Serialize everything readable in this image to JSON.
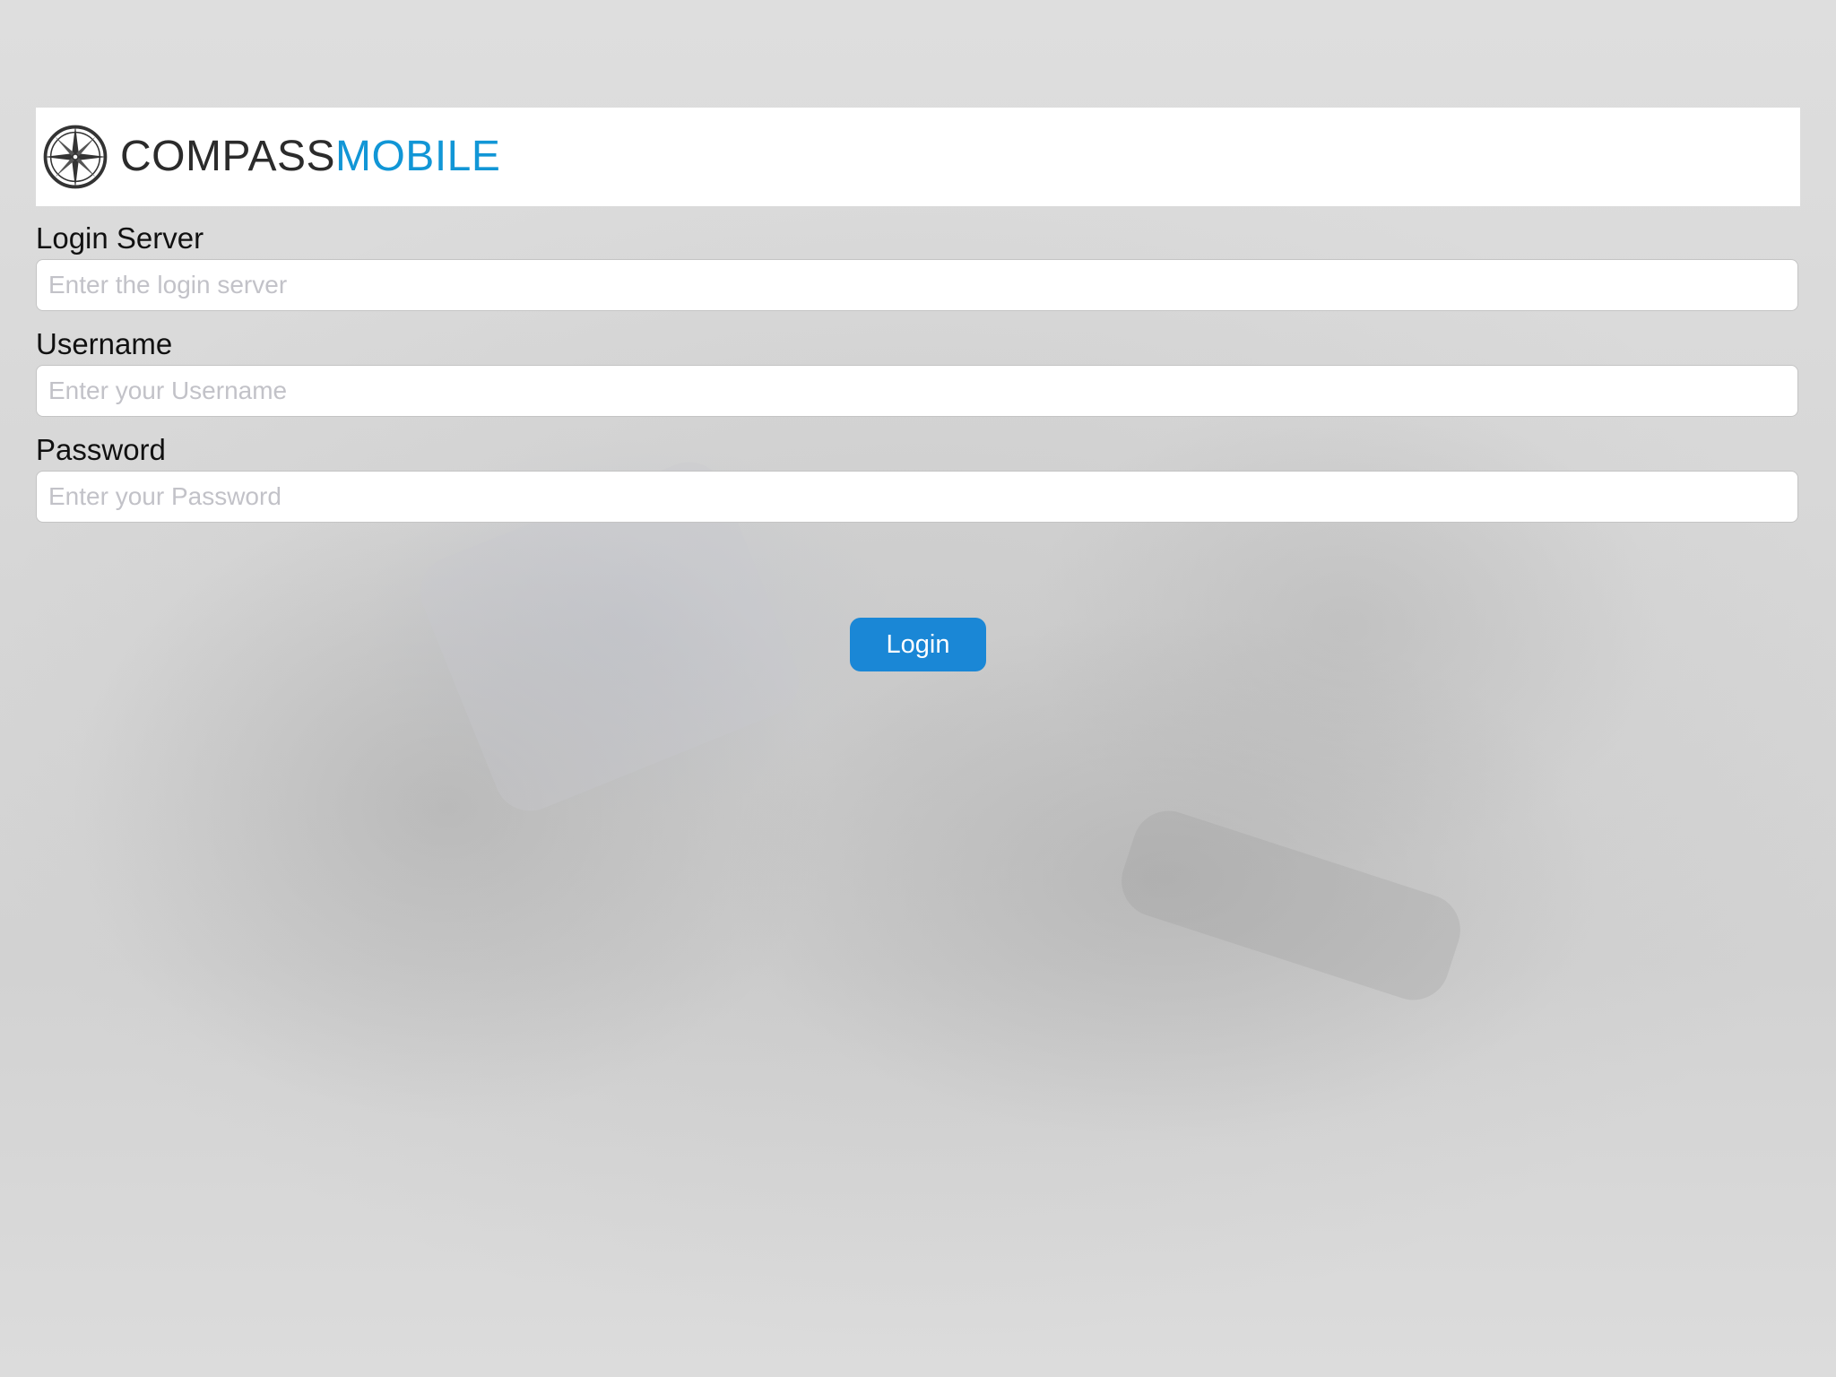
{
  "brand": {
    "name_part1": "COMPASS",
    "name_part2": "MOBILE",
    "logo_icon": "compass-rose-icon",
    "dark_color": "#2b2b2b",
    "accent_color": "#1196d6"
  },
  "form": {
    "login_server": {
      "label": "Login Server",
      "value": "",
      "placeholder": "Enter the login server"
    },
    "username": {
      "label": "Username",
      "value": "",
      "placeholder": "Enter your Username"
    },
    "password": {
      "label": "Password",
      "value": "",
      "placeholder": "Enter your Password"
    },
    "submit_label": "Login",
    "button_color": "#1a87d6"
  }
}
